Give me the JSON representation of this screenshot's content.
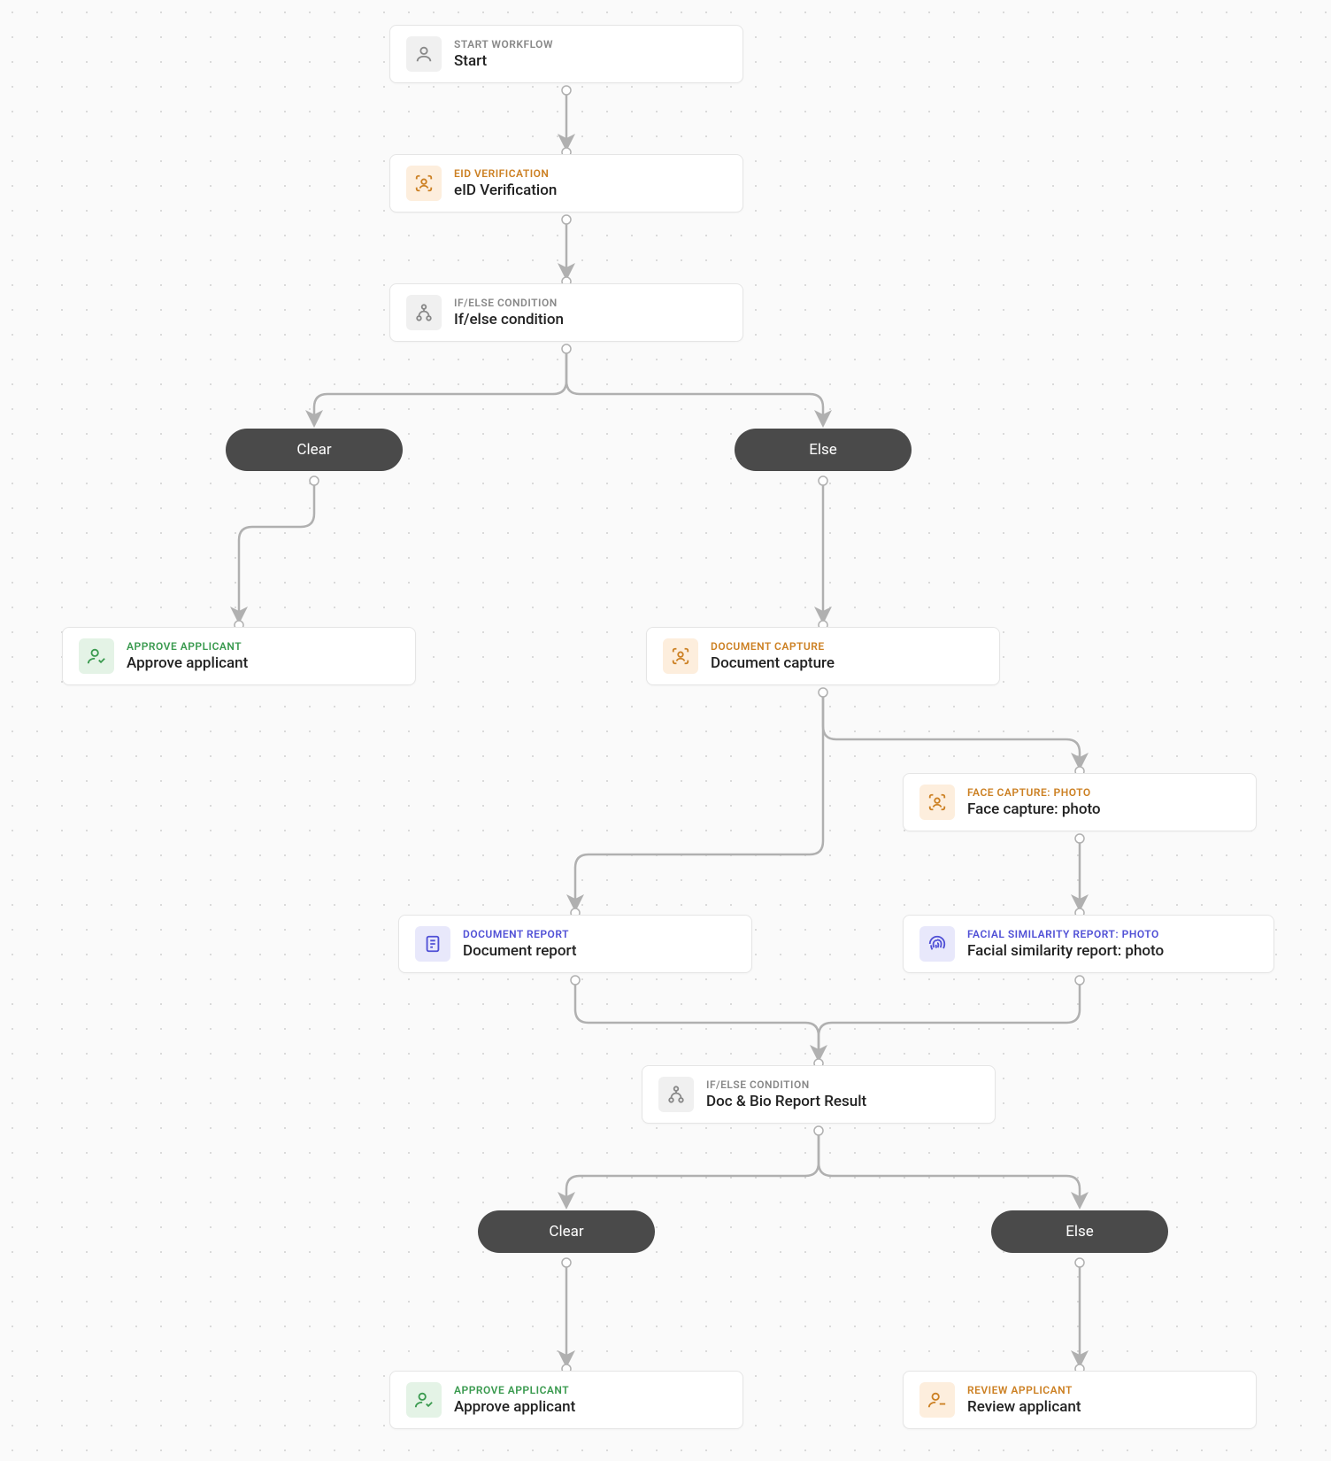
{
  "nodes": {
    "start": {
      "label": "START WORKFLOW",
      "title": "Start"
    },
    "eid": {
      "label": "EID VERIFICATION",
      "title": "eID Verification"
    },
    "ifelse1": {
      "label": "IF/ELSE CONDITION",
      "title": "If/else condition"
    },
    "approve1": {
      "label": "APPROVE APPLICANT",
      "title": "Approve applicant"
    },
    "doccapture": {
      "label": "DOCUMENT CAPTURE",
      "title": "Document capture"
    },
    "facecapture": {
      "label": "FACE CAPTURE: PHOTO",
      "title": "Face capture: photo"
    },
    "docreport": {
      "label": "DOCUMENT REPORT",
      "title": "Document report"
    },
    "facialreport": {
      "label": "FACIAL SIMILARITY REPORT: PHOTO",
      "title": "Facial similarity report: photo"
    },
    "ifelse2": {
      "label": "IF/ELSE CONDITION",
      "title": "Doc & Bio Report Result"
    },
    "approve2": {
      "label": "APPROVE APPLICANT",
      "title": "Approve applicant"
    },
    "review": {
      "label": "REVIEW APPLICANT",
      "title": "Review applicant"
    }
  },
  "pills": {
    "clear1": "Clear",
    "else1": "Else",
    "clear2": "Clear",
    "else2": "Else"
  }
}
